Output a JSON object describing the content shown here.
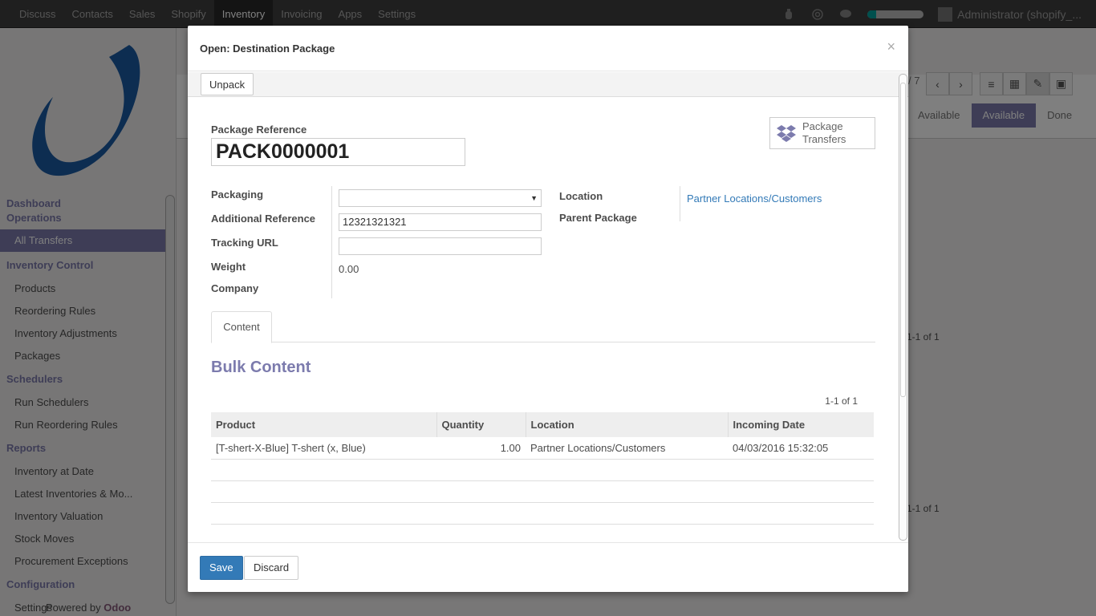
{
  "topbar": {
    "menu": [
      "Discuss",
      "Contacts",
      "Sales",
      "Shopify",
      "Inventory",
      "Invoicing",
      "Apps",
      "Settings"
    ],
    "active_menu": "Inventory",
    "user": "Administrator (shopify_..."
  },
  "sidebar": {
    "sections": [
      {
        "title": "Dashboard",
        "items": []
      },
      {
        "title": "Operations",
        "items": [
          "All Transfers"
        ]
      },
      {
        "title": "Inventory Control",
        "items": [
          "Products",
          "Reordering Rules",
          "Inventory Adjustments",
          "Packages"
        ]
      },
      {
        "title": "Schedulers",
        "items": [
          "Run Schedulers",
          "Run Reordering Rules"
        ]
      },
      {
        "title": "Reports",
        "items": [
          "Inventory at Date",
          "Latest Inventories & Mo...",
          "Inventory Valuation",
          "Stock Moves",
          "Procurement Exceptions"
        ]
      },
      {
        "title": "Configuration",
        "items": [
          "Settings"
        ]
      }
    ],
    "active_item": "All Transfers",
    "powered_by": "Powered by",
    "powered_brand": "Odoo"
  },
  "background": {
    "pager": "/ 7",
    "status_steps": [
      "Available",
      "Available",
      "Done"
    ],
    "pager2": "1-1 of 1",
    "pager3": "1-1 of 1"
  },
  "modal": {
    "title": "Open: Destination Package",
    "close": "×",
    "unpack_label": "Unpack",
    "package_reference_label": "Package Reference",
    "package_reference_value": "PACK0000001",
    "smart_button": {
      "line1": "Package",
      "line2": "Transfers"
    },
    "fields": {
      "packaging_label": "Packaging",
      "packaging_value": "",
      "additional_reference_label": "Additional Reference",
      "additional_reference_value": "12321321321",
      "tracking_url_label": "Tracking URL",
      "tracking_url_value": "",
      "weight_label": "Weight",
      "weight_value": "0.00",
      "company_label": "Company",
      "location_label": "Location",
      "location_value": "Partner Locations/Customers",
      "parent_package_label": "Parent Package"
    },
    "tab_content": "Content",
    "bulk_title": "Bulk Content",
    "pager": "1-1 of 1",
    "table": {
      "headers": [
        "Product",
        "Quantity",
        "Location",
        "Incoming Date"
      ],
      "rows": [
        [
          "[T-shert-X-Blue] T-shert (x, Blue)",
          "1.00",
          "Partner Locations/Customers",
          "04/03/2016 15:32:05"
        ]
      ]
    },
    "save_label": "Save",
    "discard_label": "Discard"
  },
  "colors": {
    "accent": "#7c7bad",
    "primary": "#337ab7",
    "brand": "#875a7b"
  }
}
